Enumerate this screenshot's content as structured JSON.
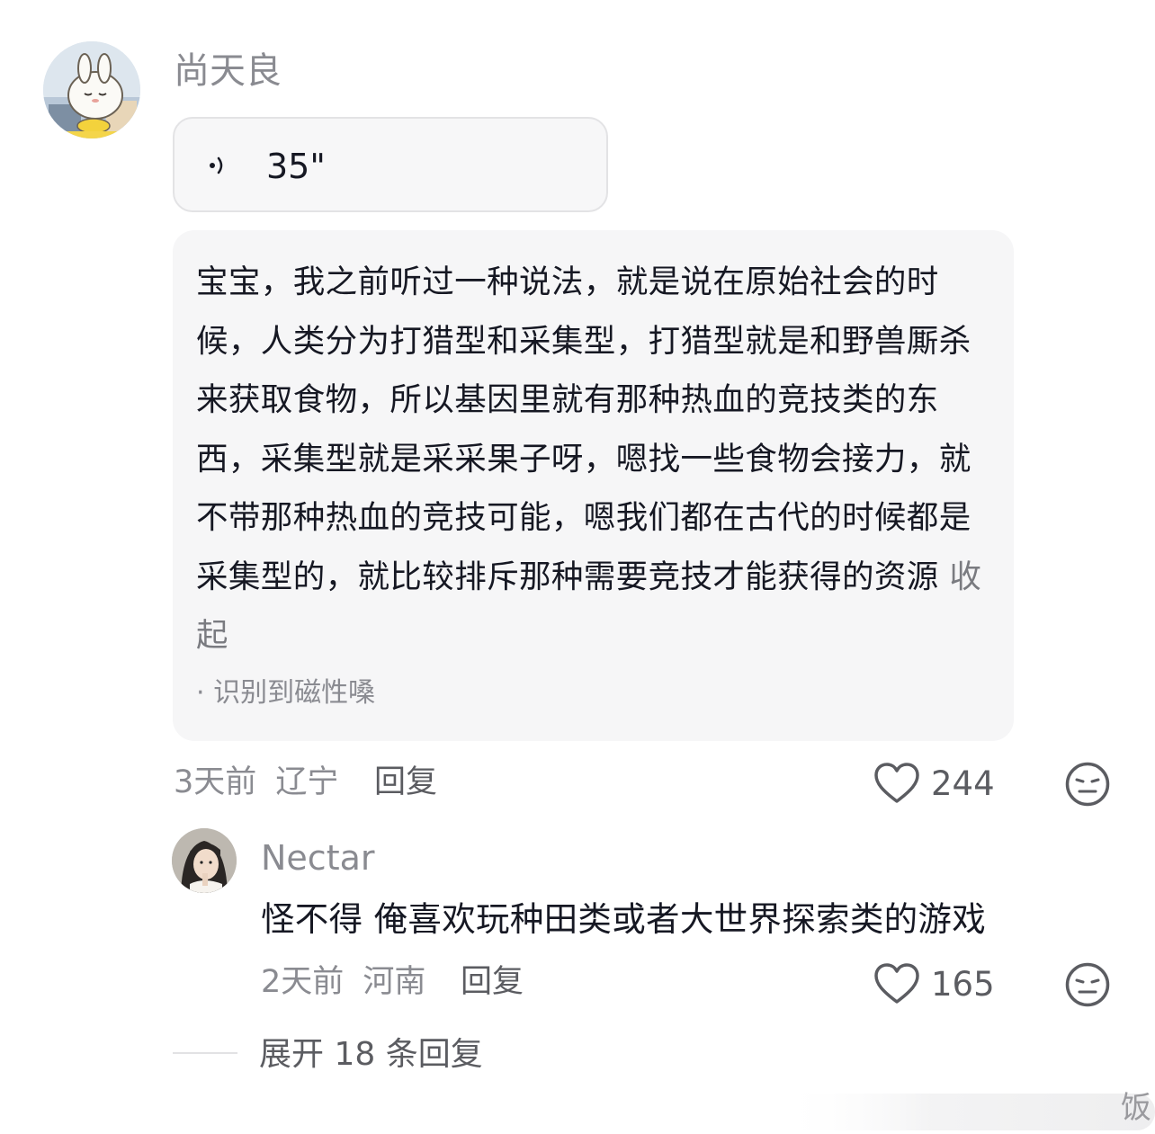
{
  "comment": {
    "username": "尚天良",
    "voice": {
      "duration": "35\""
    },
    "transcript": {
      "text": "宝宝，我之前听过一种说法，就是说在原始社会的时候，人类分为打猎型和采集型，打猎型就是和野兽厮杀来获取食物，所以基因里就有那种热血的竞技类的东西，采集型就是采采果子呀，嗯找一些食物会接力，就不带那种热血的竞技可能，嗯我们都在古代的时候都是采集型的，就比较排斥那种需要竞技才能获得的资源",
      "collapse_label": "收起",
      "note": "· 识别到磁性嗓"
    },
    "time": "3天前",
    "location": "辽宁",
    "reply_label": "回复",
    "like_count": "244"
  },
  "reply": {
    "username": "Nectar",
    "text": "怪不得 俺喜欢玩种田类或者大世界探索类的游戏",
    "time": "2天前",
    "location": "河南",
    "reply_label": "回复",
    "like_count": "165"
  },
  "expand_label": "展开 18 条回复",
  "watermark_text": "饭",
  "colors": {
    "text_primary": "#161823",
    "text_secondary": "#8a8b91",
    "bubble_bg": "#f6f6f7"
  }
}
